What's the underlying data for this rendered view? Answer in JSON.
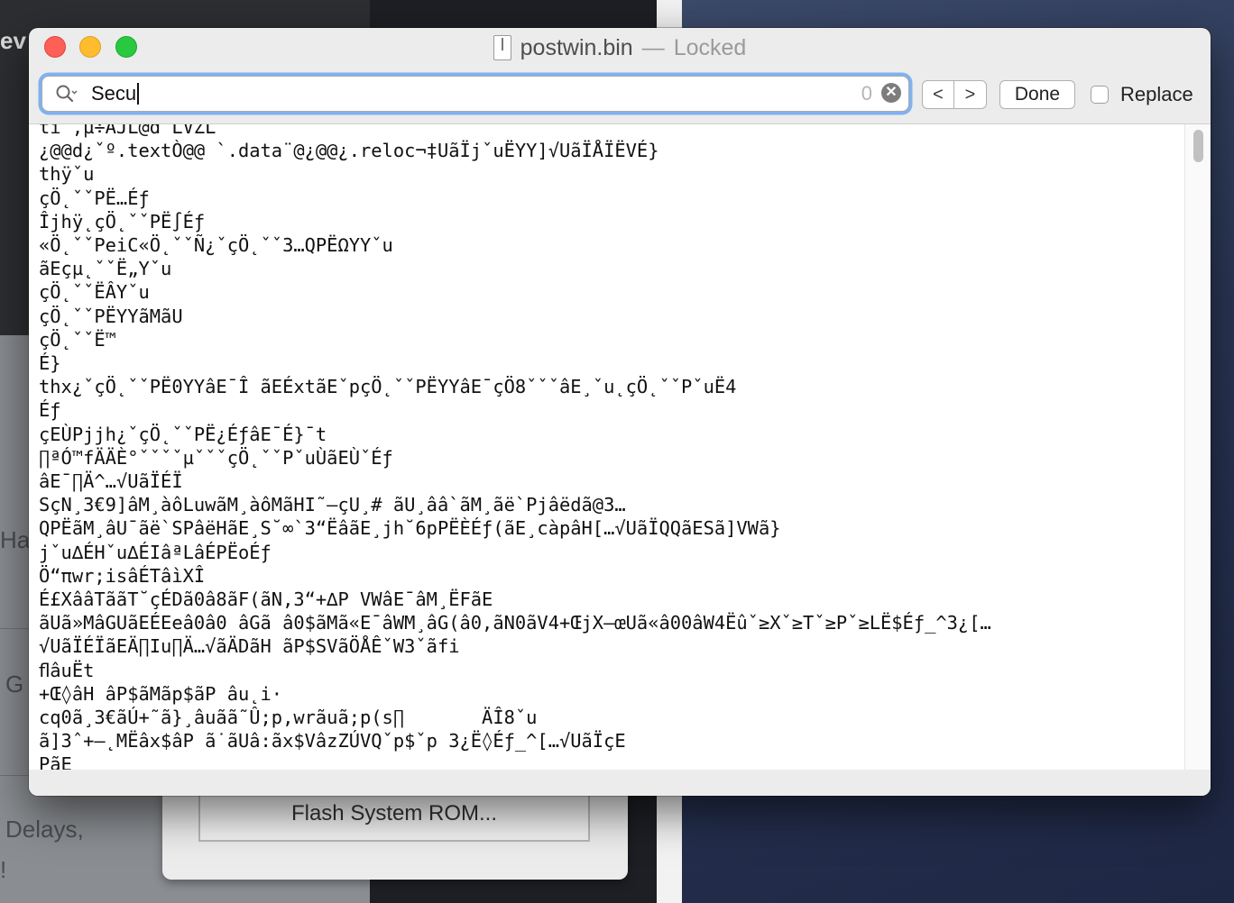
{
  "background": {
    "fragments": [
      "ev",
      "Ha",
      "G",
      "Delays,",
      "!"
    ],
    "sheet_button": "Flash System ROM..."
  },
  "window": {
    "filename": "postwin.bin",
    "separator": "—",
    "status": "Locked",
    "controls": {
      "close": "close",
      "minimize": "minimize",
      "zoom": "zoom"
    }
  },
  "find_bar": {
    "query": "Secu",
    "match_count": "0",
    "prev_label": "<",
    "next_label": ">",
    "done_label": "Done",
    "replace_label": "Replace",
    "replace_checked": false,
    "focus_ring_color": "#7fb2f0"
  },
  "content": {
    "lines": [
      "ti¯,µ÷AJL@d¨LVZL",
      "¿@@d¿ˇº.textÒ@@ `.data¨@¿@@¿.reloc¬‡UãÏjˇuËYY]√UãÏÅÏËVÉ}",
      "thÿˇu",
      "çÖ˛ˇˇPË…Éƒ",
      "Îjhÿ˛çÖ˛ˇˇPË∫Éƒ",
      "«Ö˛ˇˇPeiC«Ö˛ˇˇÑ¿ˇçÖ˛ˇˇ3…QPËΩYYˇu",
      "ãEçµ˛ˇˇË„Yˇu",
      "çÖ˛ˇˇËÂYˇu",
      "çÖ˛ˇˇPËYYãMãU",
      "çÖ˛ˇˇË™",
      "É}",
      "thx¿ˇçÖ˛ˇˇPË0YYâE¯Î ãEÉxtãEˇpçÖ˛ˇˇPËYYâE¯çÖ8ˇˇˇâE¸ˇu˛çÖ˛ˇˇPˇuË4",
      "Éƒ",
      "çEÙPjjh¿ˇçÖ˛ˇˇPË¿ÉƒâE¯É}¯t",
      "∏ªÓ™fÄÄÈ°ˇˇˇˇµˇˇˇçÖ˛ˇˇPˇuÙãEÙˇÉƒ",
      "âE¯∏Ä^…√UãÏÉÏ",
      "SçN¸3€9]âM¸àôLuwãM¸àôMãHI˜—çU¸# ãU¸ââ`ãM¸ãë`Pjâëdã@3…",
      "QPËãM¸âU¯ãë`SPâëHãE¸S˘∞`3“ËâãE¸jh˘6pPËÈÉƒ(ãE¸càpâH[…√UãÏQQãESã]VWã}",
      "jˇu∆ÉHˇu∆ÉIâªLâÉPËoÉƒ",
      "Ö“πwr;isâÉTâìXÎ",
      "É£XââTããT˘çÉDã0â8ãF(ãN,3“+∆P VWâE¯âM¸ËFãE",
      "ãUã»MâGUãEÉEeâ0â0 âGã â0$ãMã«E¯âWM¸âG(â0,ãN0ãV4+ŒjX—œUã«â00âW4Ëûˇ≥Xˇ≥Tˇ≥Pˇ≥LË$Éƒ_^3¿[…",
      "√UãÏÉÏãEÄ∏Iu∏Ä…√ãÄDãH ãP$SVãÖÅÊˇW3ˇãfi",
      "ﬂâuËt",
      "+Œ◊âH âP$ãMãp$ãP âu˛i·",
      "cq0ã¸3€ãÚ+˜ã}¸âuãã˜Û;p,wrãuã;p(s∏       ÄÎ8ˇu",
      "ã]3ˆ+—˛MËâx$âP ã˙ãUâ:ãx$VâzZÚVQˇp$ˇp 3¿Ë◊Éƒ_^[…√UãÏçE",
      "PãE"
    ]
  }
}
